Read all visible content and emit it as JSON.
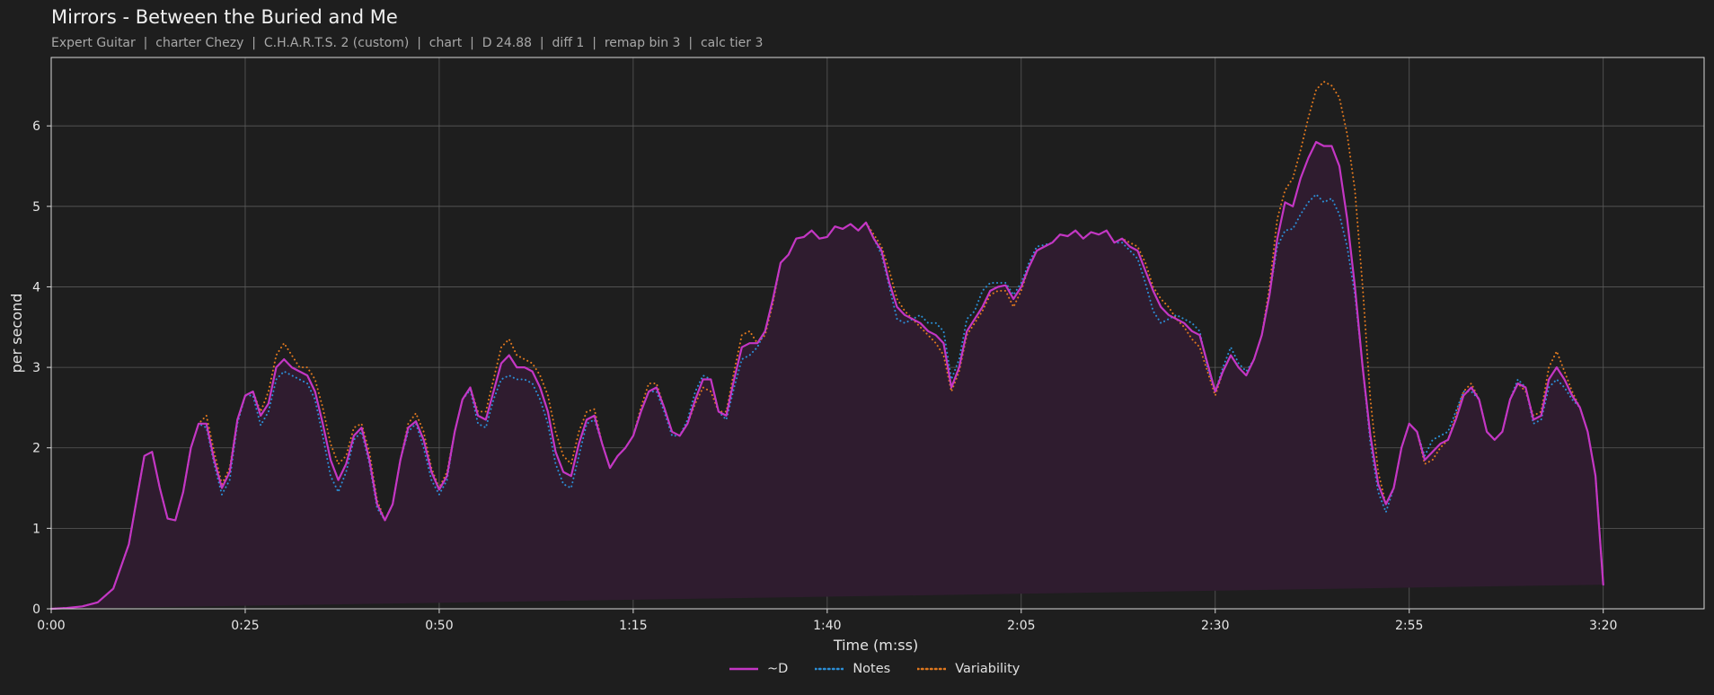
{
  "title": "Mirrors - Between the Buried and Me",
  "subtitle": "Expert Guitar  |  charter Chezy  |  C.H.A.R.T.S. 2 (custom)  |  chart  |  D 24.88  |  diff 1  |  remap bin 3  |  calc tier 3",
  "colors": {
    "background": "#1e1e1e",
    "d": "#c436c4",
    "notes": "#2b8fd6",
    "variability": "#e0781e",
    "fill": "#2f1c2f",
    "grid": "#5a5a5a"
  },
  "chart_data": {
    "type": "area",
    "title": "Mirrors - Between the Buried and Me",
    "xlabel": "Time (m:ss)",
    "ylabel": "per second",
    "xlim": [
      0,
      213
    ],
    "ylim": [
      0,
      6.85
    ],
    "grid": true,
    "legend_position": "bottom-center",
    "x_ticks": [
      0,
      25,
      50,
      75,
      100,
      125,
      150,
      175,
      200
    ],
    "x_tick_labels": [
      "0:00",
      "0:25",
      "0:50",
      "1:15",
      "1:40",
      "2:05",
      "2:30",
      "2:55",
      "3:20"
    ],
    "y_ticks": [
      0,
      1,
      2,
      3,
      4,
      5,
      6
    ],
    "y_tick_labels": [
      "0",
      "1",
      "2",
      "3",
      "4",
      "5",
      "6"
    ],
    "x": [
      0,
      2,
      4,
      6,
      8,
      10,
      11,
      12,
      13,
      14,
      15,
      16,
      17,
      18,
      19,
      20,
      21,
      22,
      23,
      24,
      25,
      26,
      27,
      28,
      29,
      30,
      31,
      32,
      33,
      34,
      35,
      36,
      37,
      38,
      39,
      40,
      41,
      42,
      43,
      44,
      45,
      46,
      47,
      48,
      49,
      50,
      51,
      52,
      53,
      54,
      55,
      56,
      57,
      58,
      59,
      60,
      61,
      62,
      63,
      64,
      65,
      66,
      67,
      68,
      69,
      70,
      71,
      72,
      73,
      74,
      75,
      76,
      77,
      78,
      79,
      80,
      81,
      82,
      83,
      84,
      85,
      86,
      87,
      88,
      89,
      90,
      91,
      92,
      93,
      94,
      95,
      96,
      97,
      98,
      99,
      100,
      101,
      102,
      103,
      104,
      105,
      106,
      107,
      108,
      109,
      110,
      111,
      112,
      113,
      114,
      115,
      116,
      117,
      118,
      119,
      120,
      121,
      122,
      123,
      124,
      125,
      126,
      127,
      128,
      129,
      130,
      131,
      132,
      133,
      134,
      135,
      136,
      137,
      138,
      139,
      140,
      141,
      142,
      143,
      144,
      145,
      146,
      147,
      148,
      149,
      150,
      151,
      152,
      153,
      154,
      155,
      156,
      157,
      158,
      159,
      160,
      161,
      162,
      163,
      164,
      165,
      166,
      167,
      168,
      169,
      170,
      171,
      172,
      173,
      174,
      175,
      176,
      177,
      178,
      179,
      180,
      181,
      182,
      183,
      184,
      185,
      186,
      187,
      188,
      189,
      190,
      191,
      192,
      193,
      194,
      195,
      196,
      197,
      198,
      199,
      200,
      201,
      202,
      203,
      204,
      205,
      206,
      207,
      208,
      209,
      210,
      211,
      212,
      213
    ],
    "series": [
      {
        "name": "~D",
        "style": "solid",
        "color": "#c436c4",
        "values": [
          0,
          0.01,
          0.03,
          0.08,
          0.25,
          0.8,
          1.35,
          1.9,
          1.95,
          1.5,
          1.12,
          1.1,
          1.45,
          2.0,
          2.3,
          2.3,
          1.85,
          1.5,
          1.7,
          2.35,
          2.65,
          2.7,
          2.4,
          2.55,
          3.0,
          3.1,
          3.0,
          2.95,
          2.9,
          2.7,
          2.3,
          1.85,
          1.6,
          1.8,
          2.15,
          2.25,
          1.85,
          1.3,
          1.1,
          1.3,
          1.85,
          2.25,
          2.33,
          2.1,
          1.7,
          1.48,
          1.65,
          2.2,
          2.6,
          2.75,
          2.4,
          2.35,
          2.7,
          3.05,
          3.15,
          3.0,
          3.0,
          2.95,
          2.75,
          2.45,
          1.95,
          1.7,
          1.65,
          2.05,
          2.35,
          2.4,
          2.05,
          1.75,
          1.9,
          2.0,
          2.15,
          2.45,
          2.7,
          2.75,
          2.5,
          2.2,
          2.15,
          2.3,
          2.6,
          2.85,
          2.85,
          2.45,
          2.4,
          2.85,
          3.25,
          3.3,
          3.3,
          3.45,
          3.85,
          4.3,
          4.4,
          4.6,
          4.62,
          4.7,
          4.6,
          4.62,
          4.75,
          4.72,
          4.78,
          4.7,
          4.8,
          4.6,
          4.45,
          4.05,
          3.75,
          3.65,
          3.6,
          3.55,
          3.45,
          3.4,
          3.3,
          2.75,
          3.0,
          3.45,
          3.6,
          3.75,
          3.95,
          4.0,
          4.02,
          3.85,
          4.0,
          4.25,
          4.45,
          4.5,
          4.55,
          4.65,
          4.63,
          4.7,
          4.6,
          4.68,
          4.65,
          4.7,
          4.55,
          4.6,
          4.5,
          4.45,
          4.2,
          3.95,
          3.75,
          3.65,
          3.6,
          3.55,
          3.45,
          3.4,
          3.05,
          2.7,
          2.95,
          3.15,
          3.0,
          2.9,
          3.1,
          3.4,
          3.9,
          4.6,
          5.05,
          5.0,
          5.35,
          5.6,
          5.8,
          5.75,
          5.75,
          5.5,
          4.85,
          4.0,
          3.0,
          2.15,
          1.55,
          1.3,
          1.5,
          2.0,
          2.3,
          2.2,
          1.85,
          1.95,
          2.05,
          2.1,
          2.35,
          2.65,
          2.75,
          2.6,
          2.2,
          2.1,
          2.2,
          2.6,
          2.8,
          2.75,
          2.35,
          2.4,
          2.85,
          3.0,
          2.85,
          2.65,
          2.5,
          2.2,
          1.65,
          0.3
        ]
      },
      {
        "name": "Notes",
        "style": "dotted",
        "color": "#2b8fd6",
        "values": [
          0,
          0.01,
          0.03,
          0.08,
          0.25,
          0.8,
          1.35,
          1.9,
          1.95,
          1.5,
          1.12,
          1.1,
          1.45,
          2.0,
          2.3,
          2.25,
          1.8,
          1.42,
          1.6,
          2.3,
          2.65,
          2.65,
          2.28,
          2.45,
          2.85,
          2.95,
          2.9,
          2.85,
          2.8,
          2.6,
          2.15,
          1.65,
          1.45,
          1.7,
          2.1,
          2.2,
          1.8,
          1.25,
          1.1,
          1.3,
          1.85,
          2.2,
          2.3,
          2.0,
          1.6,
          1.42,
          1.6,
          2.2,
          2.6,
          2.72,
          2.3,
          2.25,
          2.6,
          2.85,
          2.9,
          2.85,
          2.85,
          2.8,
          2.6,
          2.3,
          1.8,
          1.55,
          1.5,
          1.9,
          2.3,
          2.35,
          2.05,
          1.75,
          1.9,
          2.0,
          2.15,
          2.45,
          2.7,
          2.7,
          2.45,
          2.15,
          2.15,
          2.35,
          2.7,
          2.9,
          2.85,
          2.45,
          2.35,
          2.75,
          3.1,
          3.15,
          3.25,
          3.45,
          3.85,
          4.3,
          4.4,
          4.6,
          4.62,
          4.7,
          4.6,
          4.62,
          4.75,
          4.72,
          4.78,
          4.7,
          4.8,
          4.6,
          4.4,
          4.0,
          3.6,
          3.55,
          3.6,
          3.65,
          3.55,
          3.55,
          3.45,
          2.85,
          3.1,
          3.6,
          3.7,
          3.95,
          4.05,
          4.05,
          4.05,
          3.9,
          4.05,
          4.3,
          4.5,
          4.52,
          4.55,
          4.65,
          4.63,
          4.7,
          4.6,
          4.68,
          4.65,
          4.7,
          4.55,
          4.55,
          4.45,
          4.35,
          4.05,
          3.7,
          3.55,
          3.6,
          3.65,
          3.6,
          3.55,
          3.45,
          3.0,
          2.7,
          3.0,
          3.25,
          3.05,
          2.95,
          3.1,
          3.4,
          3.9,
          4.5,
          4.7,
          4.72,
          4.9,
          5.05,
          5.15,
          5.05,
          5.1,
          4.9,
          4.5,
          3.9,
          3.0,
          2.05,
          1.45,
          1.2,
          1.5,
          2.0,
          2.3,
          2.2,
          1.9,
          2.1,
          2.15,
          2.2,
          2.45,
          2.7,
          2.7,
          2.6,
          2.2,
          2.1,
          2.2,
          2.6,
          2.85,
          2.75,
          2.3,
          2.35,
          2.75,
          2.85,
          2.75,
          2.6,
          2.5,
          2.2,
          1.65,
          0.3
        ]
      },
      {
        "name": "Variability",
        "style": "dotted",
        "color": "#e0781e",
        "values": [
          0,
          0.01,
          0.03,
          0.08,
          0.25,
          0.8,
          1.35,
          1.9,
          1.95,
          1.5,
          1.12,
          1.1,
          1.45,
          2.0,
          2.3,
          2.4,
          1.95,
          1.55,
          1.75,
          2.35,
          2.65,
          2.7,
          2.45,
          2.7,
          3.15,
          3.3,
          3.15,
          3.0,
          3.0,
          2.85,
          2.5,
          2.05,
          1.8,
          1.9,
          2.25,
          2.3,
          1.95,
          1.35,
          1.1,
          1.3,
          1.85,
          2.3,
          2.43,
          2.2,
          1.75,
          1.5,
          1.7,
          2.2,
          2.6,
          2.75,
          2.45,
          2.45,
          2.85,
          3.25,
          3.35,
          3.15,
          3.1,
          3.05,
          2.9,
          2.65,
          2.2,
          1.9,
          1.8,
          2.2,
          2.45,
          2.48,
          2.05,
          1.75,
          1.9,
          2.0,
          2.15,
          2.5,
          2.8,
          2.8,
          2.5,
          2.2,
          2.15,
          2.3,
          2.55,
          2.75,
          2.7,
          2.45,
          2.45,
          2.95,
          3.4,
          3.45,
          3.3,
          3.4,
          3.8,
          4.3,
          4.4,
          4.6,
          4.62,
          4.7,
          4.6,
          4.62,
          4.75,
          4.72,
          4.78,
          4.7,
          4.8,
          4.65,
          4.5,
          4.2,
          3.85,
          3.7,
          3.6,
          3.5,
          3.4,
          3.3,
          3.15,
          2.7,
          2.95,
          3.4,
          3.55,
          3.7,
          3.9,
          3.95,
          3.95,
          3.75,
          3.95,
          4.25,
          4.45,
          4.5,
          4.55,
          4.65,
          4.63,
          4.7,
          4.6,
          4.68,
          4.65,
          4.7,
          4.55,
          4.6,
          4.55,
          4.5,
          4.3,
          4.0,
          3.85,
          3.75,
          3.6,
          3.5,
          3.35,
          3.25,
          2.95,
          2.65,
          2.95,
          3.15,
          3.0,
          2.9,
          3.1,
          3.4,
          4.0,
          4.85,
          5.2,
          5.35,
          5.7,
          6.1,
          6.45,
          6.55,
          6.5,
          6.35,
          5.9,
          5.2,
          4.0,
          2.6,
          1.7,
          1.3,
          1.5,
          2.0,
          2.3,
          2.2,
          1.8,
          1.85,
          2.0,
          2.1,
          2.4,
          2.7,
          2.8,
          2.6,
          2.2,
          2.1,
          2.2,
          2.6,
          2.8,
          2.7,
          2.4,
          2.45,
          3.0,
          3.2,
          2.95,
          2.7,
          2.5,
          2.2,
          1.65,
          0.3
        ]
      }
    ]
  }
}
